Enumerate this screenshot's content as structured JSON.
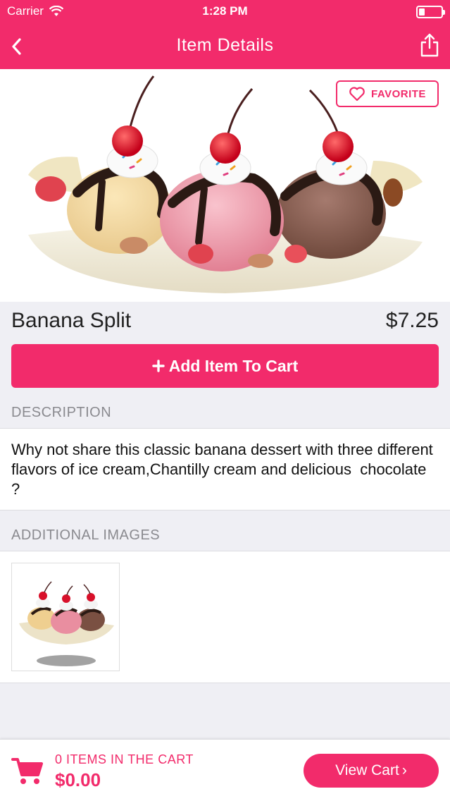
{
  "status_bar": {
    "carrier": "Carrier",
    "time": "1:28 PM"
  },
  "nav": {
    "title": "Item Details",
    "back_icon": "chevron-left-icon",
    "share_icon": "share-icon"
  },
  "hero": {
    "favorite_label": "FAVORITE",
    "favorite_icon": "heart-outline-icon",
    "image_subject": "banana split with three ice cream scoops and cherries"
  },
  "item": {
    "name": "Banana Split",
    "price": "$7.25"
  },
  "actions": {
    "add_to_cart_label": "Add Item To Cart",
    "add_icon": "plus-icon"
  },
  "description": {
    "header": "DESCRIPTION",
    "text": "Why not share this classic banana dessert with three different flavors of ice cream,Chantilly cream and delicious  chocolate ?"
  },
  "additional_images": {
    "header": "ADDITIONAL IMAGES"
  },
  "footer": {
    "cart_count_label": "0 ITEMS IN THE CART",
    "cart_total": "$0.00",
    "view_cart_label": "View Cart",
    "view_cart_chevron": "›",
    "cart_icon": "shopping-cart-icon"
  },
  "colors": {
    "accent": "#f22b6b",
    "background": "#efeff4"
  }
}
